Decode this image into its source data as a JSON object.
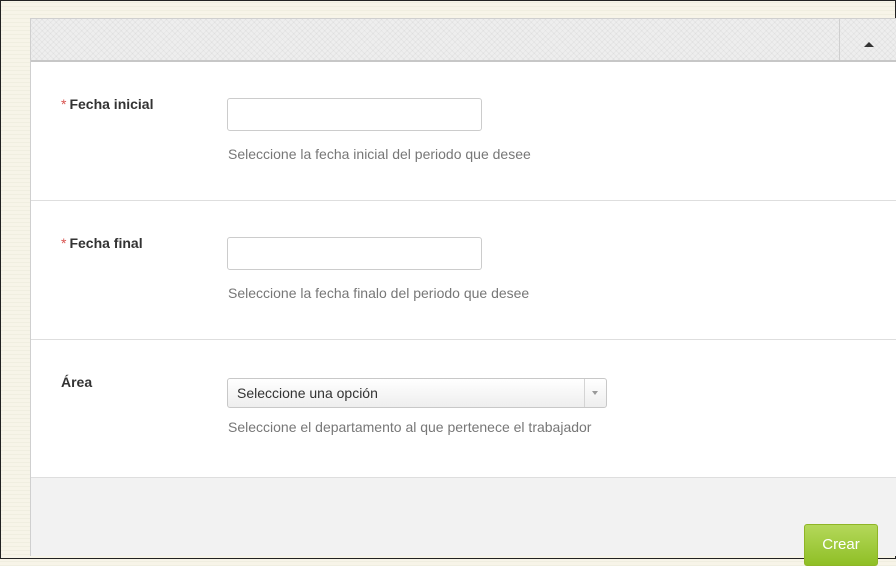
{
  "header": {
    "collapse_icon": "triangle-up-icon"
  },
  "fields": {
    "fecha_inicial": {
      "required_mark": "*",
      "label": "Fecha inicial",
      "value": "",
      "placeholder": "",
      "help": "Seleccione la fecha inicial del periodo que desee"
    },
    "fecha_final": {
      "required_mark": "*",
      "label": "Fecha final",
      "value": "",
      "placeholder": "",
      "help": "Seleccione la fecha finalo del periodo que desee"
    },
    "area": {
      "label": "Área",
      "selected": "Seleccione una opción",
      "dropdown_icon": "chevron-down-icon",
      "help": "Seleccione el departamento al que pertenece el trabajador"
    }
  },
  "footer": {
    "submit_label": "Crear"
  },
  "colors": {
    "required": "#d9534f",
    "submit_button": "#9ccb3b",
    "help_text": "#777777"
  }
}
